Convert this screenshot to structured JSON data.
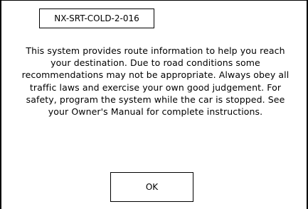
{
  "dialog": {
    "code": "NX-SRT-COLD-2-016",
    "message": "This system provides route information to help you reach your destination. Due to road conditions some recommendations may not be appropriate. Always obey all traffic laws and exercise your own good judgement. For safety, program the system while the car is stopped. See your Owner's Manual for complete instructions.",
    "ok_label": "OK"
  }
}
